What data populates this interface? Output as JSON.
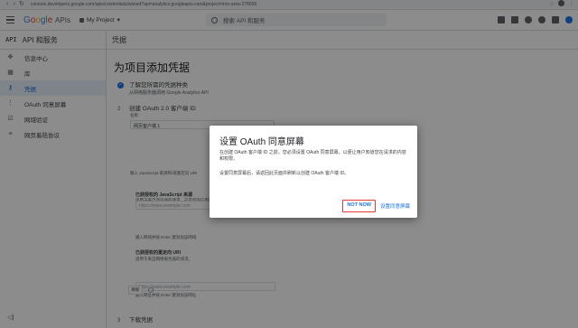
{
  "browser": {
    "url": "console.developers.google.com/apis/credentials/wizard?api=analytics.googleapis.com&project=iron-area-278009"
  },
  "header": {
    "logo_text": "Google APIs",
    "project_name": "My Project",
    "search_placeholder": "搜索 API 和服务"
  },
  "sidebar": {
    "title": "API 和服务",
    "items": [
      {
        "label": "信息中心",
        "icon": "dashboard-icon"
      },
      {
        "label": "库",
        "icon": "library-icon"
      },
      {
        "label": "凭据",
        "icon": "key-icon"
      },
      {
        "label": "OAuth 同意屏幕",
        "icon": "consent-icon"
      },
      {
        "label": "网域验证",
        "icon": "checkbox-icon"
      },
      {
        "label": "网页着陆协议",
        "icon": "settings-icon"
      }
    ],
    "active_index": 2
  },
  "main": {
    "top_title": "凭据",
    "page_title": "为项目添加凭据",
    "step1_title": "了解您所需的凭据种类",
    "step1_sub": "从网络服务器调用 Google Analytics API",
    "step2_num": "2",
    "step2_title": "创建 OAuth 2.0 客户端 ID",
    "name_label": "名称",
    "name_value": "网页客户端 1",
    "restrictions_text": "输入 JavaScript 来源和/或重定向 URI",
    "js_origins_title": "已获授权的 JavaScript 来源",
    "js_origins_desc": "适用于来自浏览器的请求。这是您的应用的来源 URI。",
    "js_origin_placeholder": "https://www.example.com",
    "js_hint": "输入网域并按 Enter 键添加该网域",
    "redirect_title": "已获授权的重定向 URI",
    "redirect_desc": "适用于来自网络服务器的请求。",
    "redirect_placeholder": "https://www.example.com",
    "redirect_hint": "输入网址并按 Enter 键添加该网址",
    "create_label": "刷新",
    "step3_num": "3",
    "step3_title": "下载凭据"
  },
  "dialog": {
    "title": "设置 OAuth 同意屏幕",
    "paragraph1": "在创建 OAuth 客户端 ID 之前，您必须设置 OAuth 同意屏幕，以便让用户知道您在请求的内容和权限。",
    "paragraph2": "设置同意屏幕后，请返回此页面并刷新以创建 OAuth 客户端 ID。",
    "not_now_label": "NOT NOW",
    "setup_label": "设置同意屏幕"
  }
}
